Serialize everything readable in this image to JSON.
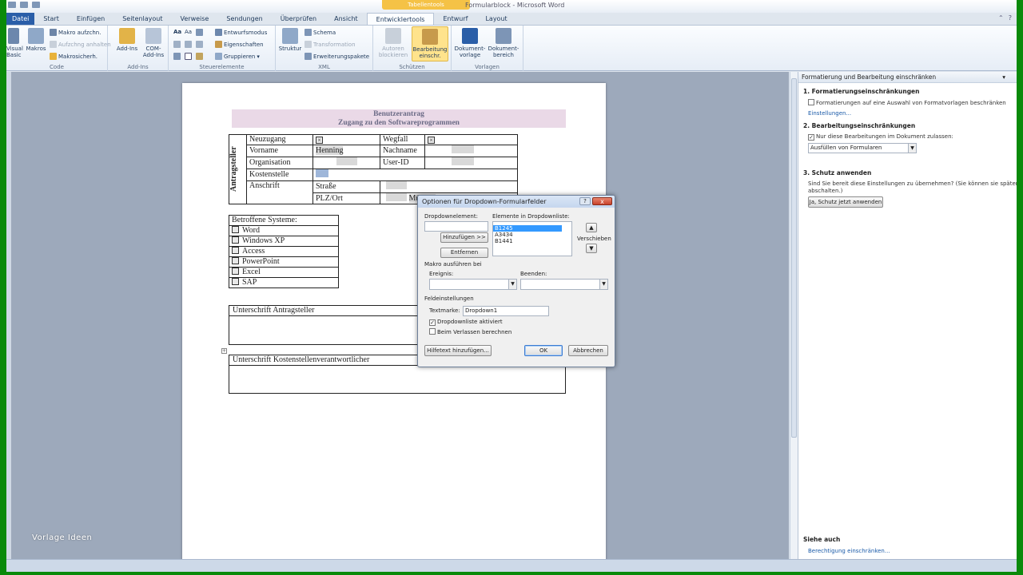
{
  "window": {
    "title": "Formularblock - Microsoft Word",
    "context_tab": "Tabellentools"
  },
  "tabs": [
    "Datei",
    "Start",
    "Einfügen",
    "Seitenlayout",
    "Verweise",
    "Sendungen",
    "Überprüfen",
    "Ansicht",
    "Entwicklertools",
    "Entwurf",
    "Layout"
  ],
  "ribbon": {
    "code": {
      "label": "Code",
      "visual_basic": "Visual Basic",
      "makros": "Makros",
      "makro_aufz": "Makro aufzchn.",
      "aufzeichnung_anhalten": "Aufzchng anhalten",
      "makrosicherheit": "Makrosicherh."
    },
    "addins": {
      "label": "Add-Ins",
      "addins": "Add-Ins",
      "com_addins": "COM-Add-Ins"
    },
    "steuerelemente": {
      "label": "Steuerelemente",
      "entwurfsmodus": "Entwurfsmodus",
      "eigenschaften": "Eigenschaften",
      "gruppieren": "Gruppieren"
    },
    "xml": {
      "label": "XML",
      "struktur": "Struktur",
      "schema": "Schema",
      "transformation": "Transformation",
      "erweiterungspakete": "Erweiterungspakete"
    },
    "schuetzen": {
      "label": "Schützen",
      "autoren_blockieren": "Autoren blockieren",
      "bearbeitung_einschr": "Bearbeitung einschr."
    },
    "vorlagen": {
      "label": "Vorlagen",
      "dokumentvorlage": "Dokument-vorlage",
      "dokumentbereich": "Dokument-bereich"
    }
  },
  "document": {
    "title_line1": "Benutzerantrag",
    "title_line2": "Zugang zu den Softwareprogrammen",
    "side_label": "Antragsteller",
    "rows": {
      "neuzugang": "Neuzugang",
      "wegfall": "Wegfall",
      "vorname": "Vorname",
      "vorname_value": "Henning",
      "nachname": "Nachname",
      "organisation": "Organisation",
      "user_id": "User-ID",
      "kostenstelle": "Kostenstelle",
      "anschrift": "Anschrift",
      "strasse": "Straße",
      "plz_ort": "PLZ/Ort",
      "ort_value": "Münster"
    },
    "systems_header": "Betroffene Systeme:",
    "systems": [
      "Word",
      "Windows XP",
      "Access",
      "PowerPoint",
      "Excel",
      "SAP"
    ],
    "signature1": "Unterschrift Antragsteller",
    "signature2": "Unterschrift Kostenstellenverantwortlicher"
  },
  "dialog": {
    "title": "Optionen für Dropdown-Formularfelder",
    "help": "?",
    "close": "x",
    "dropdown_element_label": "Dropdownelement:",
    "list_label": "Elemente in Dropdownliste:",
    "list_items": [
      "B1245",
      "A3434",
      "B1441"
    ],
    "add_button": "Hinzufügen >>",
    "remove_button": "Entfernen",
    "move_label": "Verschieben",
    "macro_section": "Makro ausführen bei",
    "event_label": "Ereignis:",
    "exit_label": "Beenden:",
    "field_settings": "Feldeinstellungen",
    "bookmark_label": "Textmarke:",
    "bookmark_value": "Dropdown1",
    "enabled_label": "Dropdownliste aktiviert",
    "calc_label": "Beim Verlassen berechnen",
    "helptext_button": "Hilfetext hinzufügen...",
    "ok_button": "OK",
    "cancel_button": "Abbrechen"
  },
  "pane": {
    "title": "Formatierung und Bearbeitung einschränken",
    "sec1": "1. Formatierungseinschränkungen",
    "sec1_check": "Formatierungen auf eine Auswahl von Formatvorlagen beschränken",
    "sec1_link": "Einstellungen...",
    "sec2": "2. Bearbeitungseinschränkungen",
    "sec2_check": "Nur diese Bearbeitungen im Dokument zulassen:",
    "sec2_select": "Ausfüllen von Formularen",
    "sec3": "3. Schutz anwenden",
    "sec3_text1": "Sind Sie bereit diese Einstellungen zu übernehmen? (Sie können sie später",
    "sec3_text2": "abschalten.)",
    "sec3_button": "Ja, Schutz jetzt anwenden",
    "see_also": "Siehe auch",
    "see_also_link": "Berechtigung einschränken..."
  },
  "watermark": "Vorlage Ideen",
  "colors": {
    "accent": "#2a5ea8",
    "frame": "#0a8a0a",
    "highlight": "#ffe38c"
  }
}
